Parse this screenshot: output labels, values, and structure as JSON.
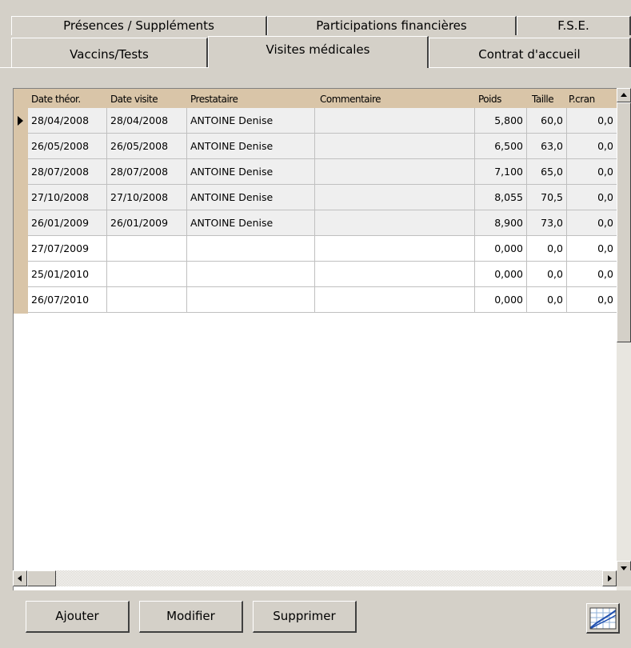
{
  "tabs": {
    "back_row": [
      {
        "label": "Présences / Suppléments"
      },
      {
        "label": "Participations financières"
      },
      {
        "label": "F.S.E."
      }
    ],
    "front_row": [
      {
        "label": "Vaccins/Tests"
      },
      {
        "label": "Visites médicales",
        "active": true
      },
      {
        "label": "Contrat d'accueil"
      }
    ]
  },
  "grid": {
    "columns": [
      "Date théor.",
      "Date visite",
      "Prestataire",
      "Commentaire",
      "Poids",
      "Taille",
      "P.cran"
    ],
    "rows": [
      [
        "28/04/2008",
        "28/04/2008",
        "ANTOINE Denise",
        "",
        "5,800",
        "60,0",
        "0,0"
      ],
      [
        "26/05/2008",
        "26/05/2008",
        "ANTOINE Denise",
        "",
        "6,500",
        "63,0",
        "0,0"
      ],
      [
        "28/07/2008",
        "28/07/2008",
        "ANTOINE Denise",
        "",
        "7,100",
        "65,0",
        "0,0"
      ],
      [
        "27/10/2008",
        "27/10/2008",
        "ANTOINE Denise",
        "",
        "8,055",
        "70,5",
        "0,0"
      ],
      [
        "26/01/2009",
        "26/01/2009",
        "ANTOINE Denise",
        "",
        "8,900",
        "73,0",
        "0,0"
      ],
      [
        "27/07/2009",
        "",
        "",
        "",
        "0,000",
        "0,0",
        "0,0"
      ],
      [
        "25/01/2010",
        "",
        "",
        "",
        "0,000",
        "0,0",
        "0,0"
      ],
      [
        "26/07/2010",
        "",
        "",
        "",
        "0,000",
        "0,0",
        "0,0"
      ]
    ],
    "current_row": 0,
    "header_color": "#d9c5a8"
  },
  "buttons": {
    "add": "Ajouter",
    "modify": "Modifier",
    "delete": "Supprimer"
  },
  "icons": {
    "chart_button": "line-chart-icon",
    "row_indicator": "current-row-arrow-icon",
    "scroll_up": "scroll-up-arrow-icon",
    "scroll_down": "scroll-down-arrow-icon",
    "scroll_left": "scroll-left-arrow-icon",
    "scroll_right": "scroll-right-arrow-icon"
  }
}
